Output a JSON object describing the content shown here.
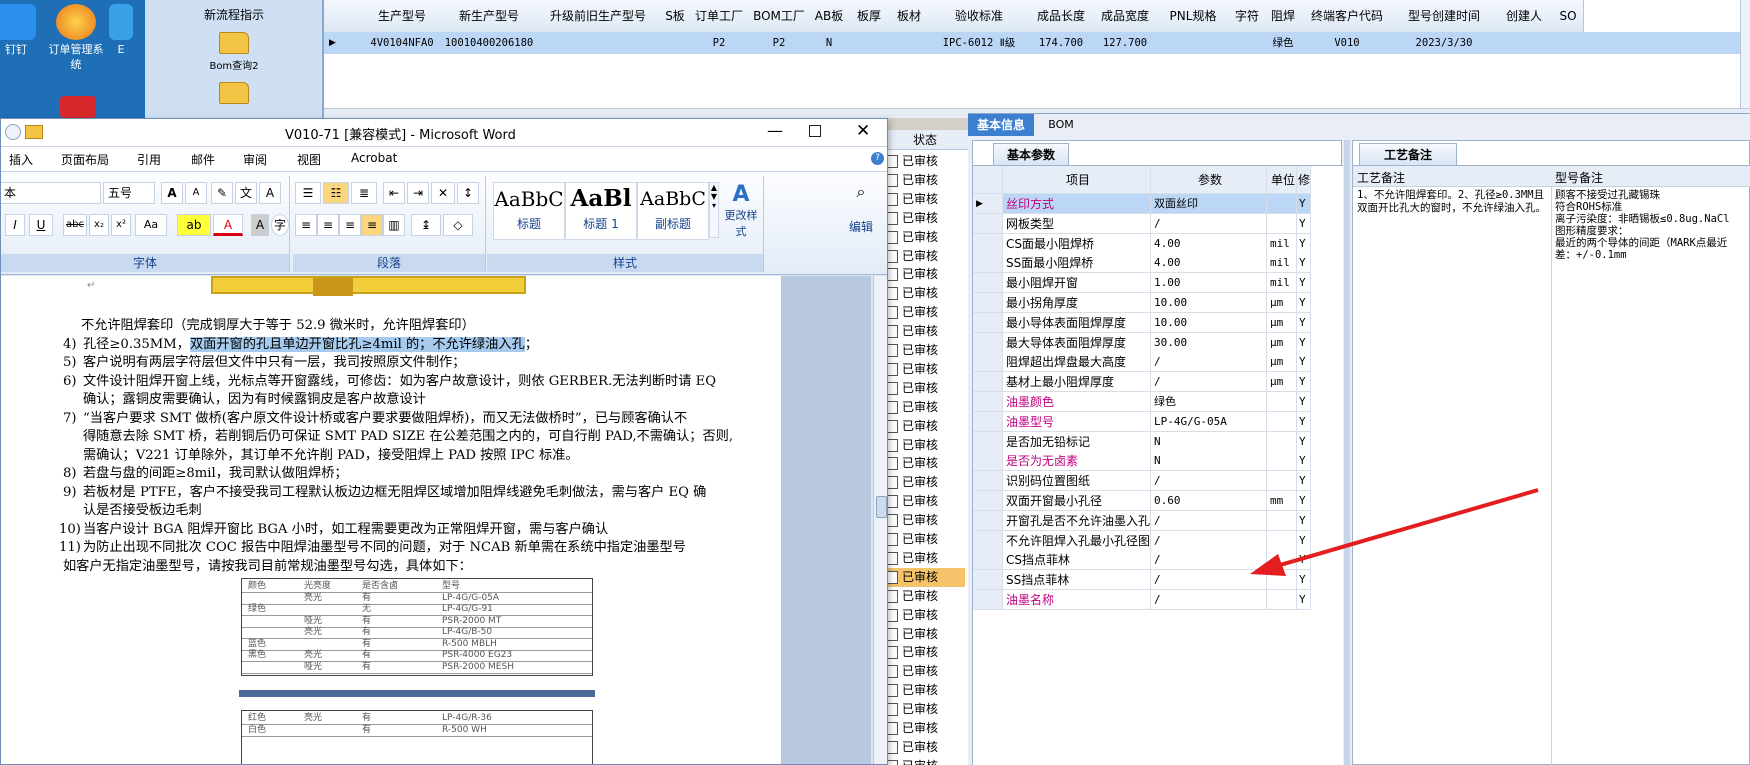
{
  "desktop": {
    "icons": [
      {
        "label": "钉钉"
      },
      {
        "label": "订单管理系统"
      },
      {
        "label": "E"
      }
    ]
  },
  "launcher": {
    "items": [
      {
        "label": "新流程指示"
      },
      {
        "label": "Bom查询2"
      },
      {
        "label": ""
      }
    ]
  },
  "top_grid": {
    "columns": [
      "生产型号",
      "新生产型号",
      "升级前旧生产型号",
      "S板",
      "订单工厂",
      "BOM工厂",
      "AB板",
      "板厚",
      "板材",
      "验收标准",
      "成品长度",
      "成品宽度",
      "PNL规格",
      "字符",
      "阻焊",
      "终端客户代码",
      "型号创建时间",
      "创建人",
      "SO"
    ],
    "row": [
      "4V0104NFA0",
      "10010400206180",
      "",
      "",
      "P2",
      "P2",
      "N",
      "",
      "",
      "IPC-6012 Ⅱ级",
      "174.700",
      "127.700",
      "",
      "",
      "绿色",
      "V010",
      "2023/3/30",
      "",
      ""
    ]
  },
  "word": {
    "title": "V010-71 [兼容模式] - Microsoft Word",
    "tabs": [
      "插入",
      "页面布局",
      "引用",
      "邮件",
      "审阅",
      "视图",
      "Acrobat"
    ],
    "font_name": "本",
    "font_size": "五号",
    "group_font": "字体",
    "group_paragraph": "段落",
    "group_styles": "样式",
    "styles": [
      {
        "preview": "AaBbC",
        "label": "标题"
      },
      {
        "preview": "AaBl",
        "label": "标题 1"
      },
      {
        "preview": "AaBbC",
        "label": "副标题"
      }
    ],
    "change_styles": "更改样式",
    "edit": "编辑",
    "doc_lines": [
      {
        "num": "",
        "text": "不允许阻焊套印（完成铜厚大于等于 52.9 微米时，允许阻焊套印）"
      },
      {
        "num": "4)",
        "text_pre": "孔径≥0.35MM，",
        "text_hl": "双面开窗的孔且单边开窗比孔≥4mil 的；不允许绿油入孔",
        "text_post": "；"
      },
      {
        "num": "5)",
        "text": "客户说明有两层字符层但文件中只有一层，我司按照原文件制作；"
      },
      {
        "num": "6)",
        "text": "文件设计阻焊开窗上线，光标点等开窗露线，可修齿：如为客户故意设计，则依 GERBER.无法判断时请 EQ"
      },
      {
        "num": "",
        "text": "确认；露铜皮需要确认，因为有时候露铜皮是客户故意设计"
      },
      {
        "num": "7)",
        "text": "“当客户要求 SMT 做桥(客户原文件设计桥或客户要求要做阻焊桥)，而又无法做桥时”，已与顾客确认不"
      },
      {
        "num": "",
        "text": "得随意去除 SMT 桥，若削铜后仍可保证 SMT PAD SIZE 在公差范围之内的，可自行削 PAD,不需确认；否则,"
      },
      {
        "num": "",
        "text": "需确认；V221 订单除外，其订单不允许削 PAD，接受阻焊上 PAD 按照 IPC 标准。"
      },
      {
        "num": "8)",
        "text": "若盘与盘的间距≥8mil，我司默认做阻焊桥；"
      },
      {
        "num": "9)",
        "text": "若板材是 PTFE，客户不接受我司工程默认板边边框无阻焊区域增加阻焊线避免毛刺做法，需与客户 EQ 确"
      },
      {
        "num": "",
        "text": "认是否接受板边毛刺"
      },
      {
        "num": "10)",
        "text": "当客户设计 BGA 阻焊开窗比 BGA 小时，如工程需要更改为正常阻焊开窗，需与客户确认"
      },
      {
        "num": "11)",
        "text": "为防止出现不同批次 COC 报告中阻焊油墨型号不同的问题，对于 NCAB 新单需在系统中指定油墨型号"
      },
      {
        "num": "",
        "text": "如客户无指定油墨型号，请按我司目前常规油墨型号勾选，具体如下："
      }
    ],
    "ink_table": [
      [
        "颜色",
        "光亮度",
        "是否含卤",
        "型号"
      ],
      [
        "",
        "亮光",
        "有",
        "LP-4G/G-05A"
      ],
      [
        "绿色",
        "",
        "无",
        "LP-4G/G-91"
      ],
      [
        "",
        "哑光",
        "有",
        "PSR-2000 MT"
      ],
      [
        "",
        "亮光",
        "有",
        "LP-4G/B-50"
      ],
      [
        "蓝色",
        "",
        "有",
        "R-500 MBLH"
      ],
      [
        "黑色",
        "亮光",
        "有",
        "PSR-4000 EG23"
      ],
      [
        "",
        "哑光",
        "有",
        "PSR-2000 MESH"
      ]
    ],
    "ink_table2": [
      [
        "红色",
        "亮光",
        "有",
        "LP-4G/R-36"
      ],
      [
        "白色",
        "",
        "有",
        "R-500 WH"
      ]
    ]
  },
  "status_strip": {
    "header": "状态",
    "items": [
      "已审核",
      "已审核",
      "已审核",
      "已审核",
      "已审核",
      "已审核",
      "已审核",
      "已审核",
      "已审核",
      "已审核",
      "已审核",
      "已审核",
      "已审核",
      "已审核",
      "已审核",
      "已审核",
      "已审核",
      "已审核",
      "已审核",
      "已审核",
      "已审核",
      "已审核",
      "已审核",
      "已审核",
      "已审核",
      "已审核",
      "已审核",
      "已审核",
      "已审核",
      "已审核",
      "已审核",
      "已审核",
      "已审核"
    ]
  },
  "right_pane": {
    "tabs": [
      "基本信息",
      "BOM"
    ],
    "subtab_basic": "基本参数",
    "subtab_process": "工艺备注",
    "columns": [
      "项目",
      "参数",
      "单位",
      "修"
    ],
    "rows": [
      {
        "item": "丝印方式",
        "value": "双面丝印",
        "unit": "",
        "flag": "Y",
        "pink": true
      },
      {
        "item": "网板类型",
        "value": "/",
        "unit": "",
        "flag": "Y",
        "pink": false
      },
      {
        "item": "CS面最小阻焊桥",
        "value": "4.00",
        "unit": "mil",
        "flag": "Y",
        "pink": false
      },
      {
        "item": "SS面最小阻焊桥",
        "value": "4.00",
        "unit": "mil",
        "flag": "Y",
        "pink": false
      },
      {
        "item": "最小阻焊开窗",
        "value": "1.00",
        "unit": "mil",
        "flag": "Y",
        "pink": false
      },
      {
        "item": "最小拐角厚度",
        "value": "10.00",
        "unit": "μm",
        "flag": "Y",
        "pink": false
      },
      {
        "item": "最小导体表面阻焊厚度",
        "value": "10.00",
        "unit": "μm",
        "flag": "Y",
        "pink": false
      },
      {
        "item": "最大导体表面阻焊厚度",
        "value": "30.00",
        "unit": "μm",
        "flag": "Y",
        "pink": false
      },
      {
        "item": "阻焊超出焊盘最大高度",
        "value": "/",
        "unit": "μm",
        "flag": "Y",
        "pink": false
      },
      {
        "item": "基材上最小阻焊厚度",
        "value": "/",
        "unit": "μm",
        "flag": "Y",
        "pink": false
      },
      {
        "item": "油墨颜色",
        "value": "绿色",
        "unit": "",
        "flag": "Y",
        "pink": true
      },
      {
        "item": "油墨型号",
        "value": "LP-4G/G-05A",
        "unit": "",
        "flag": "Y",
        "pink": true
      },
      {
        "item": "是否加无铅标记",
        "value": "N",
        "unit": "",
        "flag": "Y",
        "pink": false
      },
      {
        "item": "是否为无卤素",
        "value": "N",
        "unit": "",
        "flag": "Y",
        "pink": true
      },
      {
        "item": "识别码位置图纸",
        "value": "/",
        "unit": "",
        "flag": "Y",
        "pink": false
      },
      {
        "item": "双面开窗最小孔径",
        "value": "0.60",
        "unit": "mm",
        "flag": "Y",
        "pink": false
      },
      {
        "item": "开窗孔是否不允许油墨入孔",
        "value": "/",
        "unit": "",
        "flag": "Y",
        "pink": false
      },
      {
        "item": "不允许阻焊入孔最小孔径图纸",
        "value": "/",
        "unit": "",
        "flag": "Y",
        "pink": false
      },
      {
        "item": "CS挡点菲林",
        "value": "/",
        "unit": "",
        "flag": "Y",
        "pink": false
      },
      {
        "item": "SS挡点菲林",
        "value": "/",
        "unit": "",
        "flag": "Y",
        "pink": false
      },
      {
        "item": "油墨名称",
        "value": "/",
        "unit": "",
        "flag": "Y",
        "pink": true
      }
    ],
    "process_header": "工艺备注",
    "process_note": "1、不允许阻焊套印。2、孔径≥0.3MM且双面开比孔大的窗时，不允许绿油入孔。",
    "model_header": "型号备注",
    "model_note": "顾客不接受过孔藏锡珠\n符合ROHS标准\n离子污染度：非晒锡板≤0.8ug.NaCl\n图形精度要求：\n最近的两个导体的间距（MARK点最近\n差：+/-0.1mm"
  },
  "colors": {
    "selection": "#bcd6f5",
    "pink_label": "#c00080",
    "arrow": "#e41e1e",
    "tab_active": "#3c7fd1"
  }
}
